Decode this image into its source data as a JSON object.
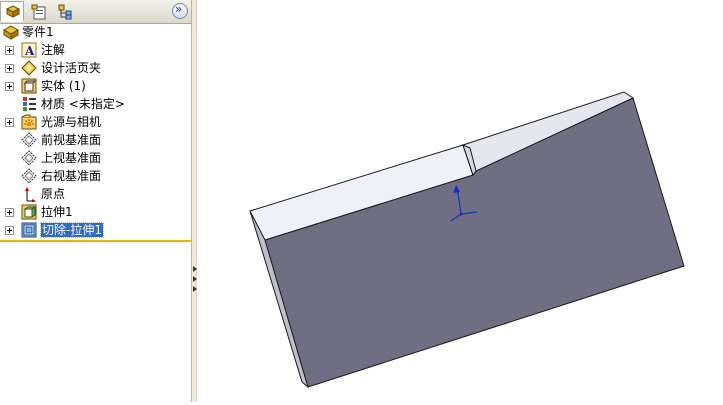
{
  "tabs": [
    {
      "name": "feature-manager",
      "icon": "feature-manager-icon",
      "active": true
    },
    {
      "name": "property-manager",
      "icon": "property-manager-icon",
      "active": false
    },
    {
      "name": "configuration-manager",
      "icon": "configuration-manager-icon",
      "active": false
    }
  ],
  "expand_button": {
    "icon": "double-chevron-right-icon"
  },
  "tree": {
    "root": {
      "label": "零件1",
      "icon": "part-icon"
    },
    "items": [
      {
        "label": "注解",
        "icon": "annotations-icon",
        "expandable": true
      },
      {
        "label": "设计活页夹",
        "icon": "design-binder-icon",
        "expandable": true
      },
      {
        "label": "实体 (1)",
        "icon": "solid-bodies-icon",
        "expandable": true
      },
      {
        "label": "材质 <未指定>",
        "icon": "material-icon",
        "expandable": false
      },
      {
        "label": "光源与相机",
        "icon": "lights-cameras-icon",
        "expandable": true
      },
      {
        "label": "前视基准面",
        "icon": "plane-icon",
        "expandable": false
      },
      {
        "label": "上视基准面",
        "icon": "plane-icon",
        "expandable": false
      },
      {
        "label": "右视基准面",
        "icon": "plane-icon",
        "expandable": false
      },
      {
        "label": "原点",
        "icon": "origin-icon",
        "expandable": false
      },
      {
        "label": "拉伸1",
        "icon": "extrude-icon",
        "expandable": true
      },
      {
        "label": "切除-拉伸1",
        "icon": "cut-extrude-icon",
        "expandable": true,
        "selected": true
      }
    ]
  },
  "viewport": {
    "model": "extruded-plate-with-cut",
    "colors": {
      "front_face": "#6f6e82",
      "top_face": "#eef0fa",
      "side_face": "#bfbfc9",
      "edge": "#1a1a1a",
      "triad": "#1030c8"
    }
  },
  "colors": {
    "selection": "#316ac5",
    "rollback_bar": "#e5b800"
  }
}
